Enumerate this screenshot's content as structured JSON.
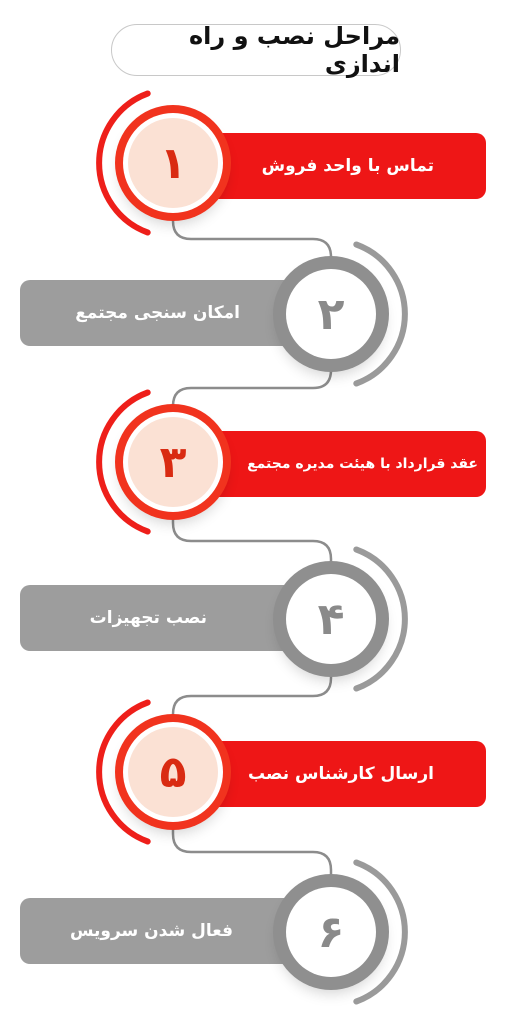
{
  "title": "مراحل نصب و راه اندازی",
  "colors": {
    "accent_red": "#ee1616",
    "neutral_gray": "#9d9d9d",
    "badge_red_fill": "#fbe1d4"
  },
  "steps": [
    {
      "number": "۱",
      "label": "تماس با واحد فروش",
      "style": "red"
    },
    {
      "number": "۲",
      "label": "امکان سنجی مجتمع",
      "style": "gray"
    },
    {
      "number": "۳",
      "label": "عقد قرارداد با هیئت مدیره مجتمع",
      "style": "red"
    },
    {
      "number": "۴",
      "label": "نصب تجهیزات",
      "style": "gray"
    },
    {
      "number": "۵",
      "label": "ارسال کارشناس نصب",
      "style": "red"
    },
    {
      "number": "۶",
      "label": "فعال شدن سرویس",
      "style": "gray"
    }
  ]
}
